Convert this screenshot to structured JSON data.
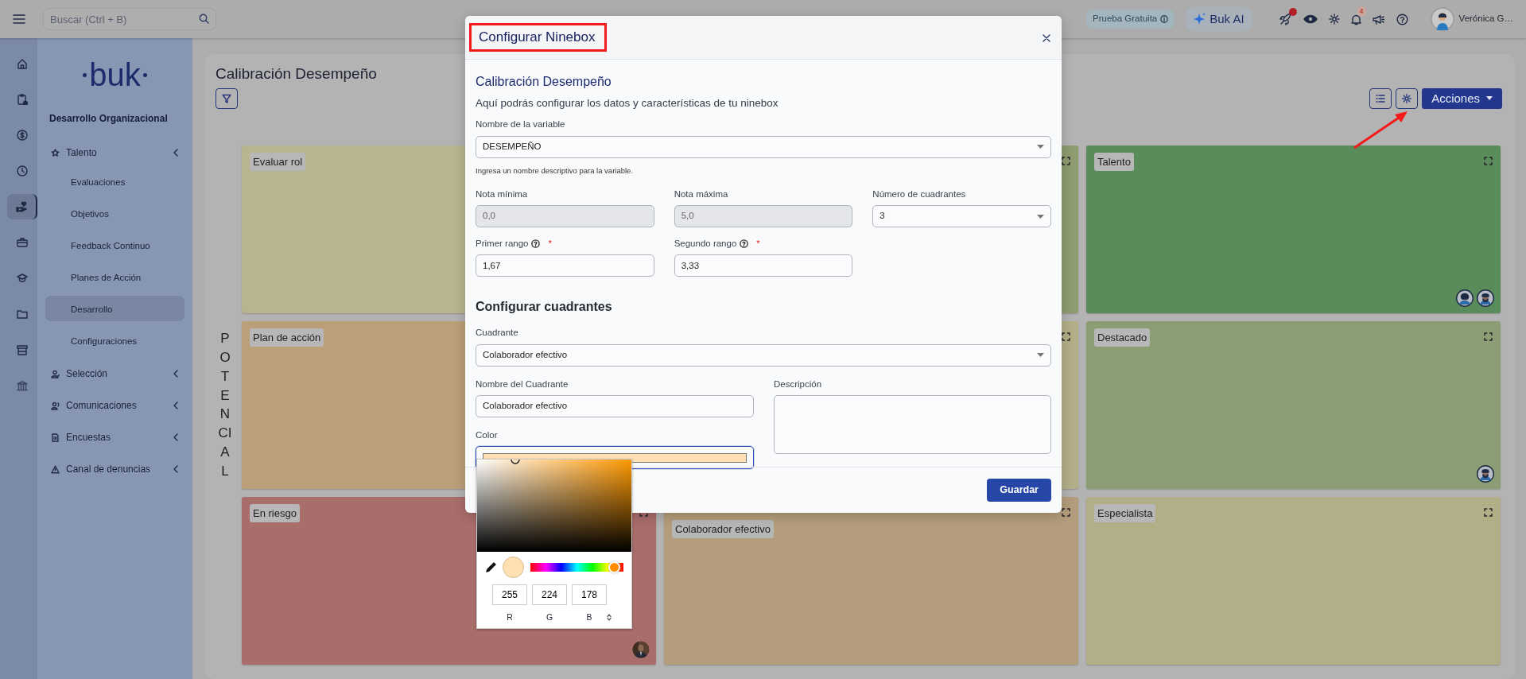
{
  "topbar": {
    "search": {
      "placeholder": "Buscar (Ctrl + B)"
    },
    "trial_badge": "Prueba Gratuita",
    "ai_button": "Buk AI",
    "notifications": "4",
    "user_name": "Verónica G…"
  },
  "rail": [
    {
      "selected": false
    },
    {
      "selected": false
    },
    {
      "selected": false
    },
    {
      "selected": false
    },
    {
      "selected": true
    },
    {
      "selected": false
    },
    {
      "selected": false
    },
    {
      "selected": false
    },
    {
      "selected": false
    },
    {
      "selected": false
    }
  ],
  "sidebar": {
    "logo": "buk",
    "section": "Desarrollo Organizacional",
    "items": [
      {
        "label": "Talento",
        "children": [
          {
            "label": "Evaluaciones",
            "selected": false
          },
          {
            "label": "Objetivos",
            "selected": false
          },
          {
            "label": "Feedback Continuo",
            "selected": false
          },
          {
            "label": "Planes de Acción",
            "selected": false
          },
          {
            "label": "Desarrollo",
            "selected": true
          },
          {
            "label": "Configuraciones",
            "selected": false
          }
        ]
      },
      {
        "label": "Selección"
      },
      {
        "label": "Comunicaciones"
      },
      {
        "label": "Encuestas"
      },
      {
        "label": "Canal de denuncias"
      }
    ]
  },
  "page": {
    "title": "Calibración Desempeño",
    "actions_button": "Acciones",
    "axis_label": "POTENCIAL",
    "quadrants": [
      {
        "label": "Evaluar rol",
        "color": "#b8b48f"
      },
      {
        "color": "#8e9c70",
        "expandable": true
      },
      {
        "label": "Talento",
        "color": "#5a8b5a",
        "expandable": true,
        "avatars": [
          {
            "kind": "woman"
          },
          {
            "kind": "man"
          }
        ]
      },
      {
        "label": "Plan de acción",
        "color": "#bb9f79"
      },
      {
        "color": "#b4ae88",
        "expandable": true
      },
      {
        "label": "Destacado",
        "color": "#8b9e73",
        "expandable": true,
        "avatars": [
          {
            "kind": "man"
          }
        ]
      },
      {
        "label": "En riesgo",
        "color": "#a96d6b",
        "expandable": true
      },
      {
        "label": "Colaborador efectivo",
        "color": "#b49d7c",
        "expandable": true
      },
      {
        "label": "Especialista",
        "color": "#b2ae88",
        "expandable": true
      }
    ]
  },
  "modal": {
    "title": "Configurar Ninebox",
    "section_title": "Calibración Desempeño",
    "description": "Aquí podrás configurar los datos y características de tu ninebox",
    "variable": {
      "label": "Nombre de la variable",
      "value": "DESEMPEÑO",
      "help": "Ingresa un nombre descriptivo para la variable."
    },
    "fields": [
      {
        "label": "Nota mínima",
        "value": "0,0",
        "kind": "readonly"
      },
      {
        "label": "Nota máxima",
        "value": "5,0",
        "kind": "readonly"
      },
      {
        "label": "Número de cuadrantes",
        "value": "3",
        "kind": "select"
      },
      {
        "label": "Primer rango",
        "value": "1,67",
        "kind": "input",
        "required_mark": "*"
      },
      {
        "label": "Segundo rango",
        "value": "3,33",
        "kind": "input",
        "required_mark": "*"
      }
    ],
    "quadrant_section": "Configurar cuadrantes",
    "quadrant_select": {
      "label": "Cuadrante",
      "value": "Colaborador efectivo"
    },
    "quadrant_name": {
      "label": "Nombre del Cuadrante",
      "value": "Colaborador efectivo"
    },
    "description_field": {
      "label": "Descripción"
    },
    "color_field": {
      "label": "Color",
      "color": "#ffe0b2"
    },
    "save_button": "Guardar"
  },
  "color_picker": {
    "level": 0.9,
    "r": "255",
    "g": "224",
    "b": "178",
    "r_label": "R",
    "g_label": "G",
    "b_label": "B"
  }
}
